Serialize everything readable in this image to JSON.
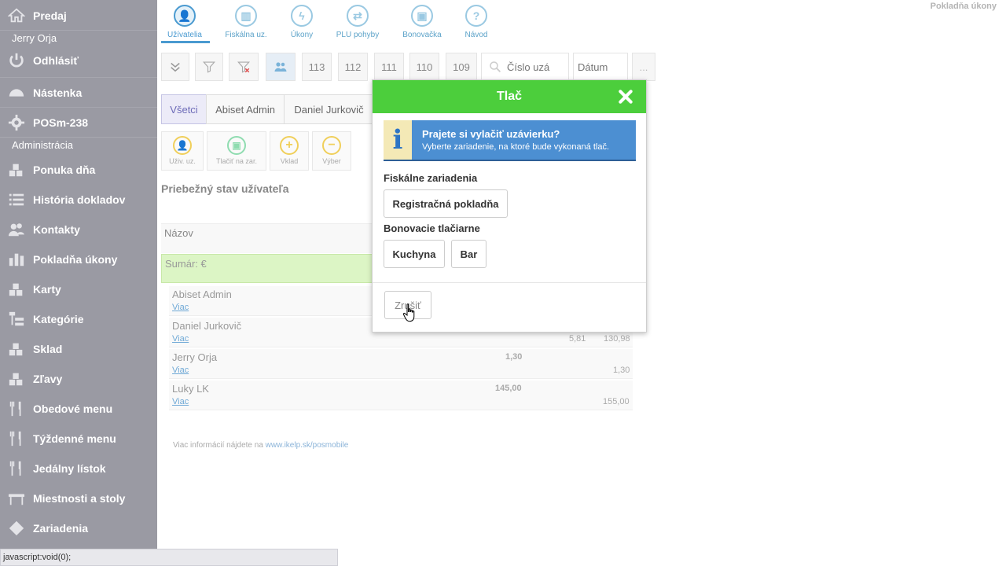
{
  "sidebar": {
    "items": [
      {
        "label": "Predaj",
        "icon": "home-icon"
      },
      {
        "label": "Odhlásiť",
        "icon": "power-icon"
      },
      {
        "label": "Nástenka",
        "icon": "dashboard-icon"
      },
      {
        "label": "POSm-238",
        "icon": "gear-icon"
      },
      {
        "label": "Ponuka dňa",
        "icon": "blocks-star-icon"
      },
      {
        "label": "História dokladov",
        "icon": "list-icon"
      },
      {
        "label": "Kontakty",
        "icon": "users-icon"
      },
      {
        "label": "Pokladňa úkony",
        "icon": "bars-icon"
      },
      {
        "label": "Karty",
        "icon": "blocks-icon"
      },
      {
        "label": "Kategórie",
        "icon": "tree-icon"
      },
      {
        "label": "Sklad",
        "icon": "blocks-icon"
      },
      {
        "label": "Zľavy",
        "icon": "blocks-icon"
      },
      {
        "label": "Obedové menu",
        "icon": "cutlery-icon"
      },
      {
        "label": "Týždenné menu",
        "icon": "cutlery-icon"
      },
      {
        "label": "Jedálny lístok",
        "icon": "cutlery-icon"
      },
      {
        "label": "Miestnosti a stoly",
        "icon": "table-icon"
      },
      {
        "label": "Zariadenia",
        "icon": "diamond-icon"
      }
    ],
    "user_name": "Jerry Orja",
    "admin_label": "Administrácia"
  },
  "status_bar": "javascript:void(0);",
  "page_label": "Pokladňa úkony",
  "top_tabs": [
    {
      "label": "Užívatelia",
      "icon": "user-icon",
      "glyph": "👤"
    },
    {
      "label": "Fiskálna uz.",
      "icon": "bars-icon",
      "glyph": "▥"
    },
    {
      "label": "Úkony",
      "icon": "lightning-icon",
      "glyph": "ϟ"
    },
    {
      "label": "PLU pohyby",
      "icon": "arrows-icon",
      "glyph": "⇄"
    },
    {
      "label": "Bonovačka",
      "icon": "printer-icon",
      "glyph": "▣"
    },
    {
      "label": "Návod",
      "icon": "help-icon",
      "glyph": "?"
    }
  ],
  "toolbar": {
    "pages": [
      "113",
      "112",
      "111",
      "110",
      "109"
    ],
    "search_placeholder": "Číslo uzá",
    "date_placeholder": "Dátum",
    "more": "..."
  },
  "filter_tabs": [
    "Všetci",
    "Abiset Admin",
    "Daniel Jurkovič"
  ],
  "actions": [
    {
      "label": "Uživ. uz.",
      "glyph": "👤"
    },
    {
      "label": "Tlačiť na zar.",
      "glyph": "▣"
    },
    {
      "label": "Vklad",
      "glyph": "+"
    },
    {
      "label": "Výber",
      "glyph": "−"
    }
  ],
  "section_title": "Priebežný stav užívateľa",
  "table": {
    "header": "Názov",
    "sum_label": "Sumár: €",
    "link_label": "Viac",
    "rows": [
      {
        "name": "Abiset Admin",
        "v1": "",
        "v2": "",
        "v3": ""
      },
      {
        "name": "Daniel Jurkovič",
        "v1": "",
        "v2": "5,81",
        "v3": "130,98"
      },
      {
        "name": "Jerry Orja",
        "v1": "1,30",
        "v2": "",
        "v3": "1,30"
      },
      {
        "name": "Luky LK",
        "v1": "145,00",
        "v2": "",
        "v3": "155,00"
      }
    ]
  },
  "footer": {
    "text": "Viac informácií nájdete na",
    "link": "www.ikelp.sk/posmobile"
  },
  "modal": {
    "title": "Tlač",
    "info_title": "Prajete si vylačiť uzávierku?",
    "info_sub": "Vyberte zariadenie, na ktoré bude vykonaná tlač.",
    "fiscal_label": "Fiskálne zariadenia",
    "fiscal_devices": [
      "Registračná pokladňa"
    ],
    "printers_label": "Bonovacie tlačiarne",
    "printers": [
      "Kuchyna",
      "Bar"
    ],
    "cancel_label": "Zrušiť"
  },
  "colors": {
    "sidebar_bg": "#9a9aa3",
    "modal_header": "#4cce3c",
    "info_bg": "#4c8fd2",
    "accent": "#4a9ad0"
  }
}
